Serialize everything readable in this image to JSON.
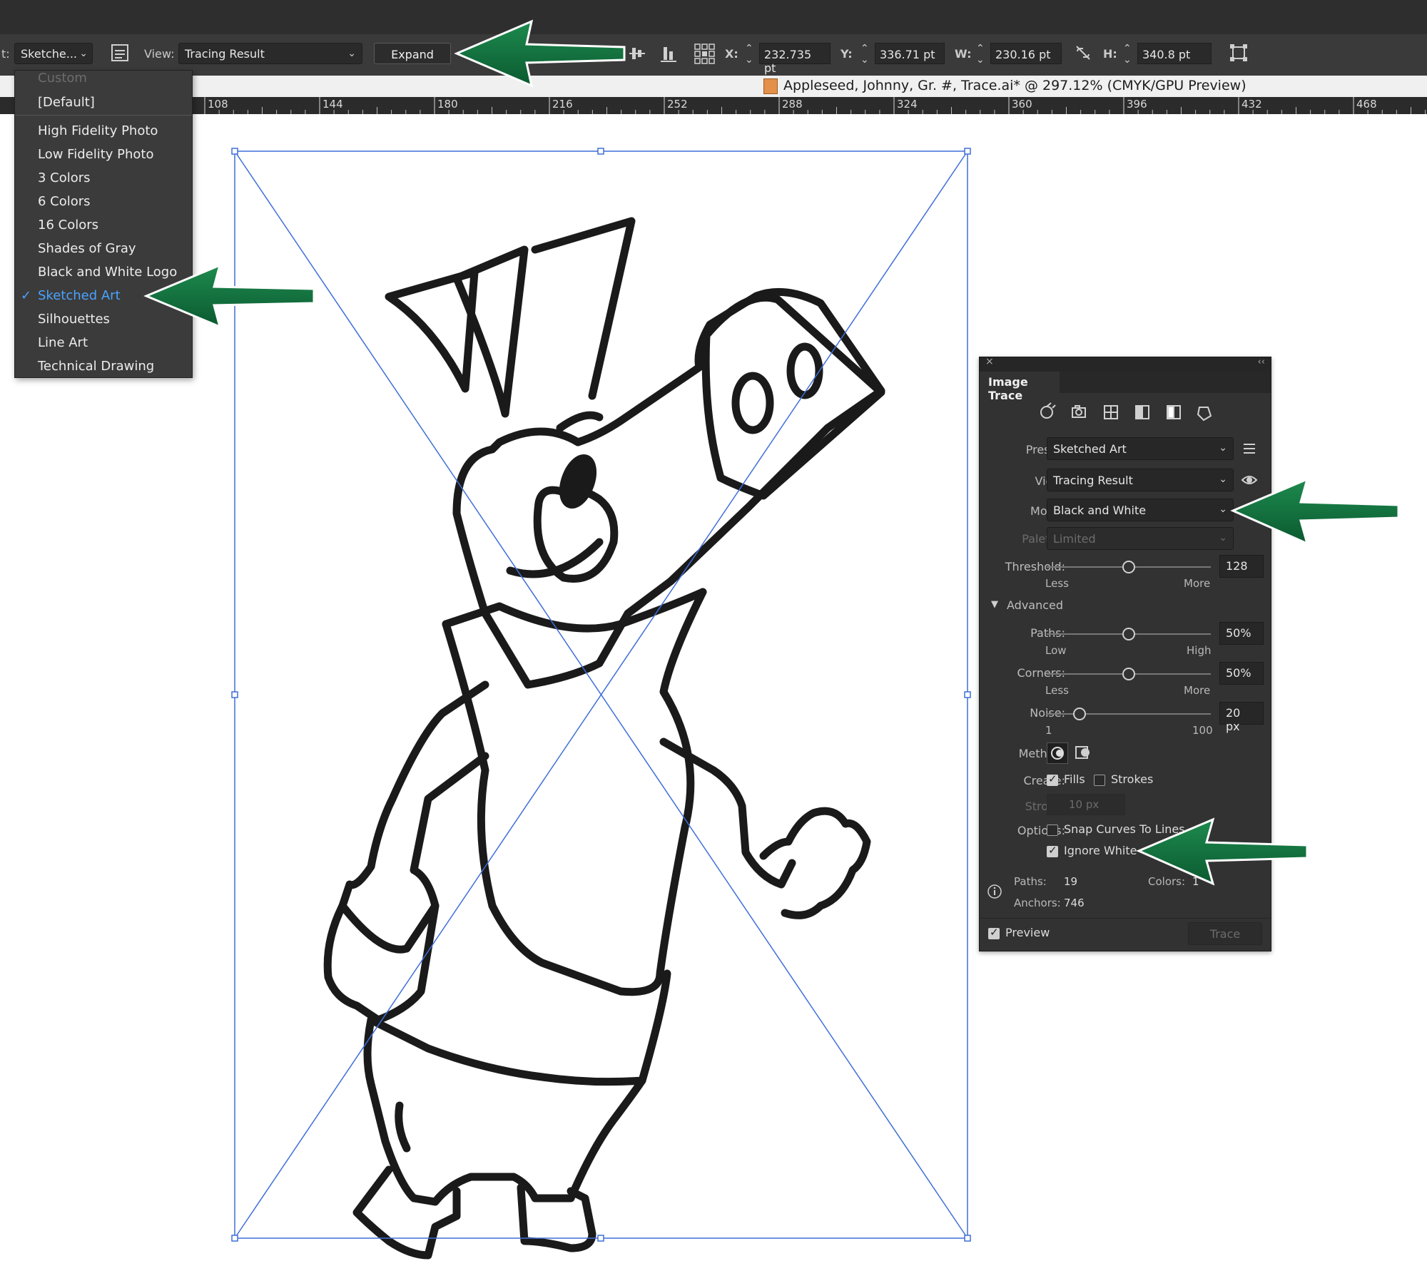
{
  "control_bar": {
    "preset_prefix": "t:",
    "preset_value": "Sketche...",
    "view_label": "View:",
    "view_value": "Tracing Result",
    "expand_label": "Expand",
    "x_label": "X:",
    "x_value": "232.735 pt",
    "y_label": "Y:",
    "y_value": "336.71 pt",
    "w_label": "W:",
    "w_value": "230.16 pt",
    "h_label": "H:",
    "h_value": "340.8 pt"
  },
  "document": {
    "title": "Appleseed, Johnny, Gr. #, Trace.ai* @ 297.12% (CMYK/GPU Preview)"
  },
  "ruler": {
    "ticks": [
      "108",
      "144",
      "180",
      "216",
      "252",
      "288",
      "324",
      "360",
      "396",
      "432",
      "468"
    ]
  },
  "preset_menu": {
    "items": [
      {
        "label": "Custom",
        "disabled": true
      },
      {
        "label": "[Default]"
      },
      {
        "label": "High Fidelity Photo"
      },
      {
        "label": "Low Fidelity Photo"
      },
      {
        "label": "3 Colors"
      },
      {
        "label": "6 Colors"
      },
      {
        "label": "16 Colors"
      },
      {
        "label": "Shades of Gray"
      },
      {
        "label": "Black and White Logo"
      },
      {
        "label": "Sketched Art",
        "checked": true
      },
      {
        "label": "Silhouettes"
      },
      {
        "label": "Line Art"
      },
      {
        "label": "Technical Drawing"
      }
    ],
    "selected_color": "#4aa3ff"
  },
  "image_trace": {
    "title": "Image Trace",
    "preset_label": "Preset:",
    "preset_value": "Sketched Art",
    "view_label": "View:",
    "view_value": "Tracing Result",
    "mode_label": "Mode:",
    "mode_value": "Black and White",
    "palette_label": "Palette:",
    "palette_value": "Limited",
    "threshold_label": "Threshold:",
    "threshold_value": "128",
    "threshold_min": "Less",
    "threshold_max": "More",
    "advanced_label": "Advanced",
    "paths_label": "Paths:",
    "paths_value": "50%",
    "paths_min": "Low",
    "paths_max": "High",
    "corners_label": "Corners:",
    "corners_value": "50%",
    "corners_min": "Less",
    "corners_max": "More",
    "noise_label": "Noise:",
    "noise_value": "20 px",
    "noise_min": "1",
    "noise_max": "100",
    "method_label": "Method:",
    "create_label": "Create:",
    "fills_label": "Fills",
    "fills_checked": true,
    "strokes_label": "Strokes",
    "strokes_checked": false,
    "stroke_label": "Stroke:",
    "stroke_value": "10 px",
    "options_label": "Options:",
    "snap_label": "Snap Curves To Lines",
    "snap_checked": false,
    "ignore_white_label": "Ignore White",
    "ignore_white_checked": true,
    "stats_paths_label": "Paths:",
    "stats_paths_value": "19",
    "stats_colors_label": "Colors:",
    "stats_colors_value": "1",
    "stats_anchors_label": "Anchors:",
    "stats_anchors_value": "746",
    "preview_label": "Preview",
    "preview_checked": true,
    "trace_label": "Trace",
    "slider_levels": {
      "threshold": 0.5,
      "paths": 0.5,
      "corners": 0.5,
      "noise": 0.2
    }
  },
  "colors": {
    "arrow_green": "#0d6b3a",
    "selection_blue": "#3f6fd8",
    "art_black": "#1a1a1a"
  }
}
